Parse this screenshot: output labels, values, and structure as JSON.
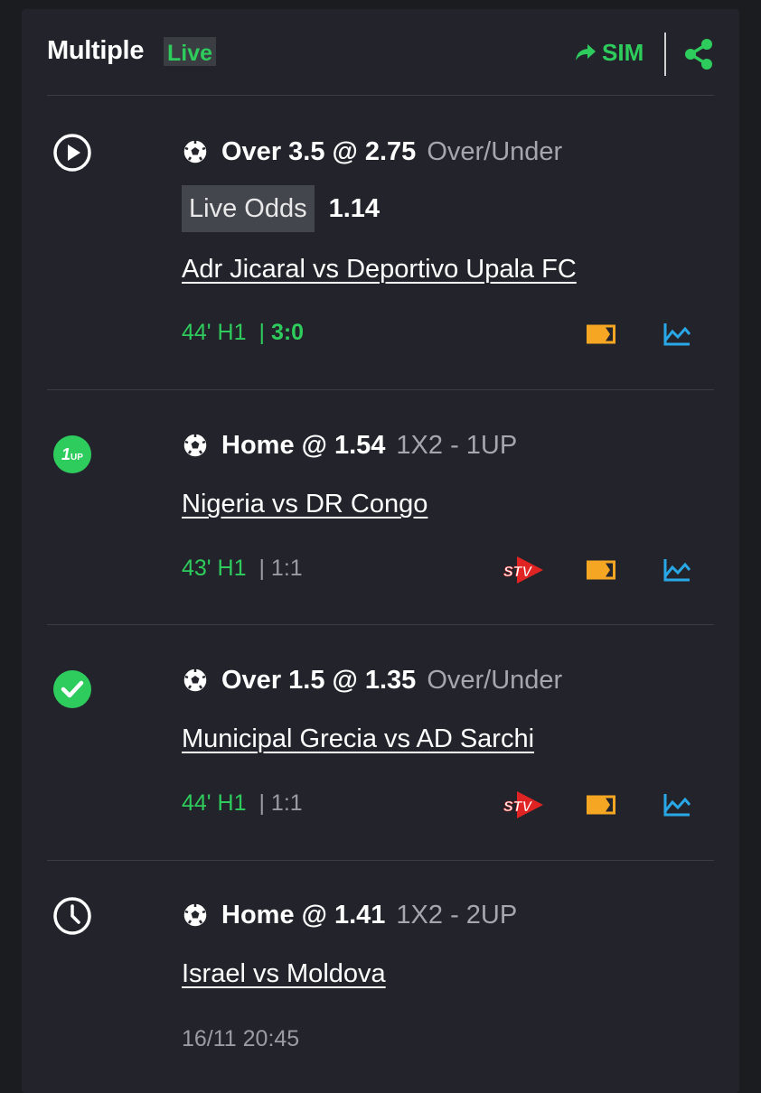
{
  "header": {
    "title": "Multiple",
    "badge": "Live",
    "sim_label": "SIM"
  },
  "bets": [
    {
      "selection": "Over 3.5 @ 2.75",
      "market": "Over/Under",
      "live_odds_label": "Live Odds",
      "live_odds_value": "1.14",
      "match": "Adr Jicaral vs Deportivo Upala FC",
      "minute": "44' H1",
      "score_sep": "|",
      "score": "3:0",
      "status_icon": "play-circle-icon"
    },
    {
      "selection": "Home @ 1.54",
      "market": "1X2 - 1UP",
      "match": "Nigeria vs DR Congo",
      "minute": "43' H1",
      "score": "| 1:1",
      "status_icon": "one-up-icon",
      "one_up": "1UP"
    },
    {
      "selection": "Over 1.5 @ 1.35",
      "market": "Over/Under",
      "match": "Municipal Grecia vs AD Sarchi",
      "minute": "44' H1",
      "score": "| 1:1",
      "status_icon": "check-circle-icon"
    },
    {
      "selection": "Home @ 1.41",
      "market": "1X2 - 2UP",
      "match": "Israel vs Moldova",
      "kickoff": "16/11 20:45",
      "status_icon": "clock-icon"
    }
  ],
  "tv_label": "STV",
  "colors": {
    "background": "#23242b",
    "accent_green": "#2ecc5d",
    "stats_blue": "#29a8e8",
    "card_yellow": "#f5a623",
    "tv_red": "#e02424"
  }
}
